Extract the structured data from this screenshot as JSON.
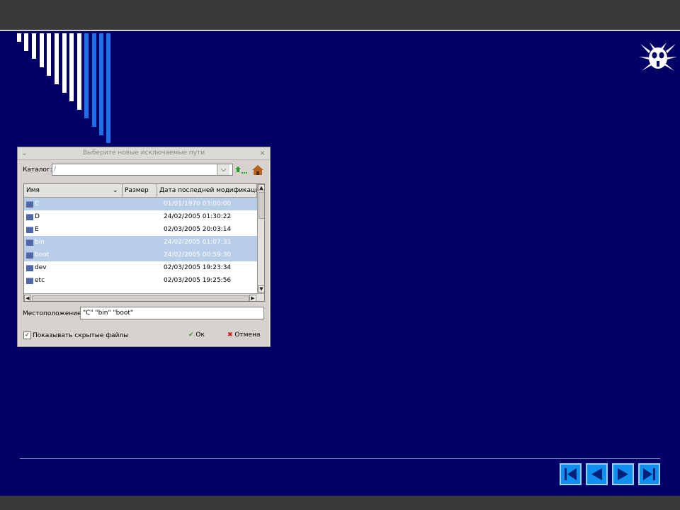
{
  "dialog": {
    "title": "Выберите новые исключаемые пути",
    "catalog_label": "Каталог:",
    "catalog_value": "/",
    "columns": [
      "Имя",
      "Размер",
      "Дата последней модификации"
    ],
    "rows": [
      {
        "name": "C",
        "date": "01/01/1970 03:00:00"
      },
      {
        "name": "D",
        "date": "24/02/2005 01:30:22"
      },
      {
        "name": "E",
        "date": "02/03/2005 20:03:14"
      },
      {
        "name": "bin",
        "date": "24/02/2005 01:07:31"
      },
      {
        "name": "boot",
        "date": "24/02/2005 00:59:30"
      },
      {
        "name": "dev",
        "date": "02/03/2005 19:23:34"
      },
      {
        "name": "etc",
        "date": "02/03/2005 19:25:56"
      }
    ],
    "location_label": "Местоположение:",
    "location_value": "\"C\" \"bin\" \"boot\"",
    "show_hidden_label": "Показывать скрытые файлы",
    "ok_label": "Ок",
    "cancel_label": "Отмена"
  },
  "colors": {
    "background": "#000066",
    "selection": "#b8cde8",
    "nav_button": "#0f8ff0"
  },
  "icons": [
    "drweb-spider-logo-icon",
    "up-folder-icon",
    "home-icon",
    "folder-icon",
    "checkmark-icon",
    "cancel-x-icon",
    "first-slide-icon",
    "previous-slide-icon",
    "next-slide-icon",
    "last-slide-icon"
  ]
}
